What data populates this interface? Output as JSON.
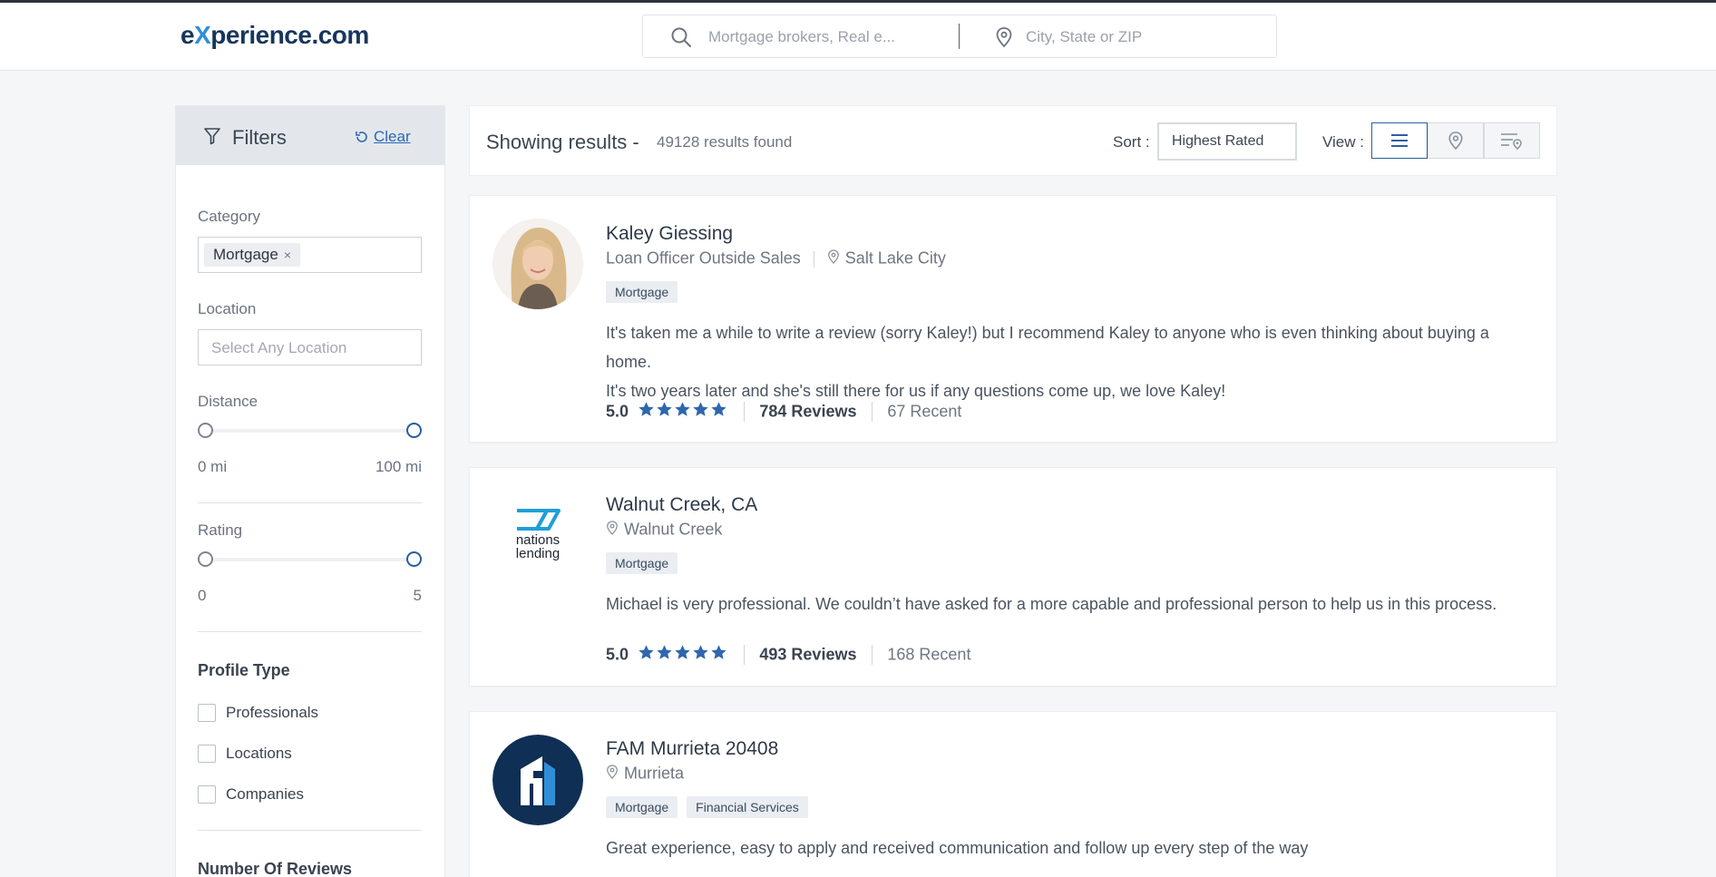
{
  "logo": {
    "prefix": "e",
    "x": "X",
    "rest": "perience.com"
  },
  "search": {
    "query_placeholder": "Mortgage brokers, Real e...",
    "location_placeholder": "City, State or ZIP"
  },
  "filters": {
    "title": "Filters",
    "clear_label": "Clear",
    "category": {
      "label": "Category",
      "selected": "Mortgage",
      "remove": "×"
    },
    "location": {
      "label": "Location",
      "placeholder": "Select Any Location"
    },
    "distance": {
      "label": "Distance",
      "min_label": "0 mi",
      "max_label": "100 mi",
      "min": 0,
      "max": 100
    },
    "rating": {
      "label": "Rating",
      "min_label": "0",
      "max_label": "5",
      "min": 0,
      "max": 5
    },
    "profile_type": {
      "title": "Profile Type",
      "options": [
        "Professionals",
        "Locations",
        "Companies"
      ]
    },
    "reviews_title": "Number Of Reviews"
  },
  "results": {
    "title": "Showing results -",
    "count": "49128 results found",
    "sort_label": "Sort :",
    "sort_value": "Highest Rated",
    "view_label": "View :",
    "views": [
      "list-view-icon",
      "map-pin-icon",
      "list-map-icon"
    ]
  },
  "cards": [
    {
      "name": "Kaley Giessing",
      "title": "Loan Officer Outside Sales",
      "location": "Salt Lake City",
      "tags": [
        "Mortgage"
      ],
      "review_line1": "It's taken me a while to write a review (sorry Kaley!) but I recommend Kaley to anyone who is even thinking about buying a home.",
      "review_line2": "It's two years later and she's still there for us if any questions come up, we love Kaley!",
      "score": "5.0",
      "reviews": "784 Reviews",
      "recent": "67 Recent"
    },
    {
      "name": "Walnut Creek, CA",
      "location": "Walnut Creek",
      "logo_text1": "nations",
      "logo_text2": "lending",
      "tags": [
        "Mortgage"
      ],
      "review_line1": "Michael is very professional. We couldn’t have asked for a more capable and professional person to help us in this process.",
      "score": "5.0",
      "reviews": "493 Reviews",
      "recent": "168 Recent"
    },
    {
      "name": "FAM Murrieta 20408",
      "location": "Murrieta",
      "tags": [
        "Mortgage",
        "Financial Services"
      ],
      "review_line1": "Great experience, easy to apply and received communication and follow up every step of the way"
    }
  ],
  "colors": {
    "accent": "#2a5ea0",
    "star": "#2f66ae",
    "brand_dark": "#17365d",
    "brand_light": "#2f8fd6"
  }
}
